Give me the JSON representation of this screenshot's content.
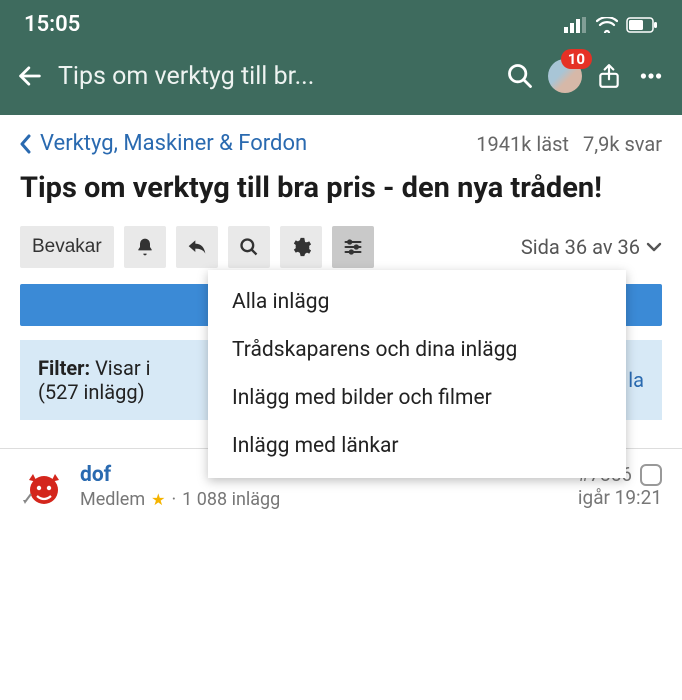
{
  "status": {
    "time": "15:05"
  },
  "nav": {
    "title": "Tips om verktyg till br...",
    "badge": "10"
  },
  "breadcrumb": {
    "label": "Verktyg, Maskiner & Fordon"
  },
  "stats": {
    "reads": "1941k läst",
    "replies": "7,9k svar"
  },
  "thread": {
    "title": "Tips om verktyg till bra pris - den nya tråden!"
  },
  "toolbar": {
    "watch": "Bevakar",
    "page_indicator": "Sida 36 av 36"
  },
  "dropdown": {
    "items": [
      "Alla inlägg",
      "Trådskaparens och dina inlägg",
      "Inlägg med bilder och filmer",
      "Inlägg med länkar"
    ]
  },
  "filter": {
    "label": "Filter:",
    "text": "Visar i",
    "count": "(527 inlägg)",
    "link": "la"
  },
  "post": {
    "user": "dof",
    "role": "Medlem",
    "posts_count": "1 088 inlägg",
    "dot": "·",
    "number": "#7856",
    "time": "igår 19:21"
  }
}
